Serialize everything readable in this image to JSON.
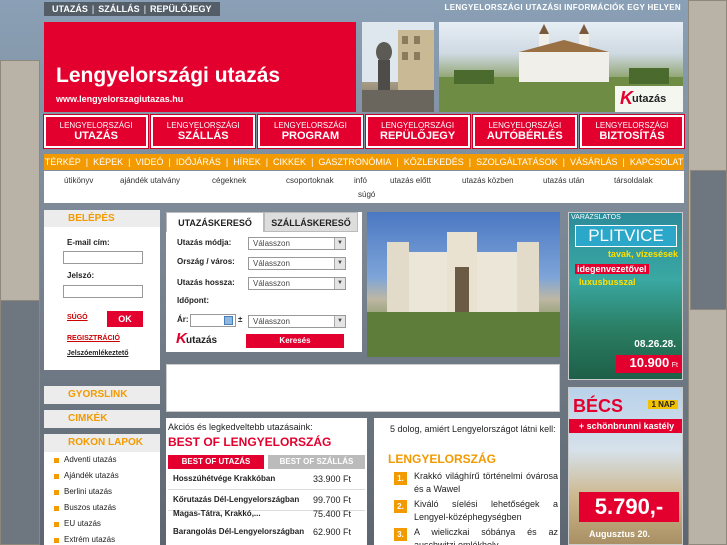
{
  "colors": {
    "brand_red": "#e3002e",
    "accent_orange": "#f29a00"
  },
  "top_nav": [
    "UTAZÁS",
    "SZÁLLÁS",
    "REPÜLŐJEGY"
  ],
  "top_right": "LENGYELORSZÁGI UTAZÁSI INFORMÁCIÓK EGY HELYEN",
  "header": {
    "title": "Lengyelországi utazás",
    "url": "www.lengyelorszagiutazas.hu",
    "logo_k": "K",
    "logo_text": "utazás"
  },
  "main_nav": [
    {
      "small": "LENGYELORSZÁGI",
      "big": "UTAZÁS"
    },
    {
      "small": "LENGYELORSZÁGI",
      "big": "SZÁLLÁS"
    },
    {
      "small": "LENGYELORSZÁGI",
      "big": "PROGRAM"
    },
    {
      "small": "LENGYELORSZÁGI",
      "big": "REPÜLŐJEGY"
    },
    {
      "small": "LENGYELORSZÁGI",
      "big": "AUTÓBÉRLÉS"
    },
    {
      "small": "LENGYELORSZÁGI",
      "big": "BIZTOSÍTÁS"
    }
  ],
  "orange_nav": [
    "TÉRKÉP",
    "KÉPEK",
    "VIDEÓ",
    "IDŐJÁRÁS",
    "HÍREK",
    "CIKKEK",
    "GASZTRONÓMIA",
    "KÖZLEKEDÉS",
    "SZOLGÁLTATÁSOK",
    "VÁSÁRLÁS",
    "KAPCSOLAT"
  ],
  "sub_nav": [
    "útikönyv",
    "ajándék utalvány",
    "cégeknek",
    "csoportoknak",
    "infó",
    "utazás előtt",
    "utazás közben",
    "utazás után",
    "társoldalak",
    "súgó"
  ],
  "login": {
    "title": "BELÉPÉS",
    "email_label": "E-mail cím:",
    "password_label": "Jelszó:",
    "help": "SÚGÓ",
    "ok": "OK",
    "register": "REGISZTRÁCIÓ",
    "forgot": "Jelszóemlékeztető"
  },
  "sidebar": {
    "quicklink": "GYORSLINK",
    "tags": "CIMKÉK",
    "related": "ROKON LAPOK",
    "related_items": [
      "Adventi utazás",
      "Ajándék utazás",
      "Berlini utazás",
      "Buszos utazás",
      "EU utazás",
      "Extrém utazás"
    ]
  },
  "search": {
    "tab_travel": "UTAZÁSKERESŐ",
    "tab_lodging": "SZÁLLÁSKERESŐ",
    "mode_label": "Utazás módja:",
    "country_label": "Ország / város:",
    "duration_label": "Utazás hossza:",
    "date_label": "Időpont:",
    "price_label": "Ár:",
    "plusminus": "±",
    "select_placeholder": "Válasszon",
    "logo_k": "K",
    "logo_text": "utazás",
    "submit": "Keresés"
  },
  "best_of": {
    "intro": "Akciós és legkedveltebb utazásaink:",
    "title": "BEST OF LENGYELORSZÁG",
    "tab_travel": "BEST OF UTAZÁS",
    "tab_lodging": "BEST OF SZÁLLÁS",
    "rows": [
      {
        "name": "Hosszúhétvége Krakkóban",
        "price": "33.900 Ft"
      },
      {
        "name": "Kőrutazás Dél-Lengyelországban",
        "price": "99.700 Ft"
      },
      {
        "name": "Magas-Tátra, Krakkó,...",
        "price": "75.400 Ft"
      },
      {
        "name": "Barangolás Dél-Lengyelországban",
        "price": "62.900 Ft"
      }
    ]
  },
  "reasons": {
    "intro": "5 dolog, amiért Lengyelországot látni kell:",
    "title": "LENGYELORSZÁG",
    "items": [
      {
        "num": "1.",
        "text": "Krakkó világhírű történelmi óvárosa és a Wawel"
      },
      {
        "num": "2.",
        "text": "Kiváló síelési lehetőségek a Lengyel-középhegységben"
      },
      {
        "num": "3.",
        "text": "A wieliczkai sóbánya és az auschwitzi emlékhely"
      }
    ]
  },
  "ad1": {
    "top": "VARÁZSLATOS",
    "title": "PLITVICE",
    "line1": "tavak, vízesések",
    "line2": "idegenvezetővel",
    "line3": "luxusbusszal",
    "dates": "08.26.28.",
    "price": "10.900",
    "currency": "Ft"
  },
  "ad2": {
    "title": "BÉCS",
    "days": "1 NAP",
    "subtitle": "+ schönbrunni kastély",
    "price": "5.790,-",
    "date": "Augusztus 20."
  }
}
